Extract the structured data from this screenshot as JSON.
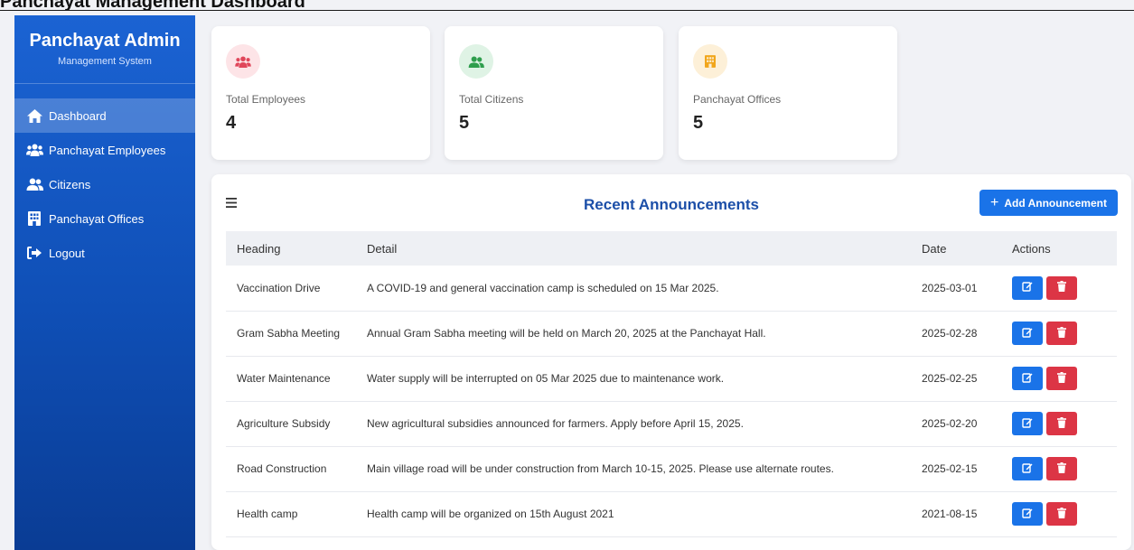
{
  "page_heading_partial": "Panchayat Management Dashboard",
  "sidebar": {
    "title": "Panchayat Admin",
    "subtitle": "Management System",
    "items": [
      {
        "label": "Dashboard",
        "icon": "home-icon",
        "active": true
      },
      {
        "label": "Panchayat Employees",
        "icon": "users-icon",
        "active": false
      },
      {
        "label": "Citizens",
        "icon": "user-group-icon",
        "active": false
      },
      {
        "label": "Panchayat Offices",
        "icon": "building-icon",
        "active": false
      },
      {
        "label": "Logout",
        "icon": "logout-icon",
        "active": false
      }
    ]
  },
  "stats": [
    {
      "label": "Total Employees",
      "value": "4",
      "icon": "users-icon",
      "color": "#e0465a",
      "bg": "#fde4e7"
    },
    {
      "label": "Total Citizens",
      "value": "5",
      "icon": "user-group-icon",
      "color": "#2e9e4d",
      "bg": "#dff3e5"
    },
    {
      "label": "Panchayat Offices",
      "value": "5",
      "icon": "building-icon",
      "color": "#f1a61c",
      "bg": "#fdf0d8"
    }
  ],
  "announcements": {
    "title": "Recent Announcements",
    "add_label": "Add Announcement",
    "columns": [
      "Heading",
      "Detail",
      "Date",
      "Actions"
    ],
    "rows": [
      {
        "heading": "Vaccination Drive",
        "detail": "A COVID-19 and general vaccination camp is scheduled on 15 Mar 2025.",
        "date": "2025-03-01"
      },
      {
        "heading": "Gram Sabha Meeting",
        "detail": "Annual Gram Sabha meeting will be held on March 20, 2025 at the Panchayat Hall.",
        "date": "2025-02-28"
      },
      {
        "heading": "Water Maintenance",
        "detail": "Water supply will be interrupted on 05 Mar 2025 due to maintenance work.",
        "date": "2025-02-25"
      },
      {
        "heading": "Agriculture Subsidy",
        "detail": "New agricultural subsidies announced for farmers. Apply before April 15, 2025.",
        "date": "2025-02-20"
      },
      {
        "heading": "Road Construction",
        "detail": "Main village road will be under construction from March 10-15, 2025. Please use alternate routes.",
        "date": "2025-02-15"
      },
      {
        "heading": "Health camp",
        "detail": "Health camp will be organized on 15th August 2021",
        "date": "2021-08-15"
      }
    ]
  },
  "colors": {
    "primary": "#1a73e8",
    "danger": "#dc3545",
    "title_blue": "#1c4fa8"
  }
}
